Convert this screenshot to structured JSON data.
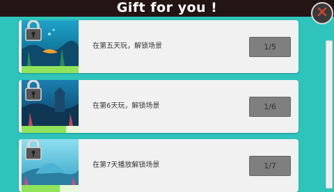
{
  "header": {
    "title": "Gift for you !",
    "close_glyph": "✕"
  },
  "items": [
    {
      "description": "在第五天玩，解锁场景",
      "progress_label": "1/5",
      "progress_fraction": 0.2,
      "lock_icon": "padlock-icon"
    },
    {
      "description": "在第6天玩，解锁场景",
      "progress_label": "1/6",
      "progress_fraction": 0.167,
      "lock_icon": "padlock-icon"
    },
    {
      "description": "在第7天播放解锁场景",
      "progress_label": "1/7",
      "progress_fraction": 0.143,
      "lock_icon": "padlock-icon"
    }
  ],
  "colors": {
    "background": "#2ec4bc",
    "title_bar": "#251414",
    "progress_fill": "#8fe45a",
    "button": "#7f7f7f",
    "close_x": "#e0452b"
  }
}
